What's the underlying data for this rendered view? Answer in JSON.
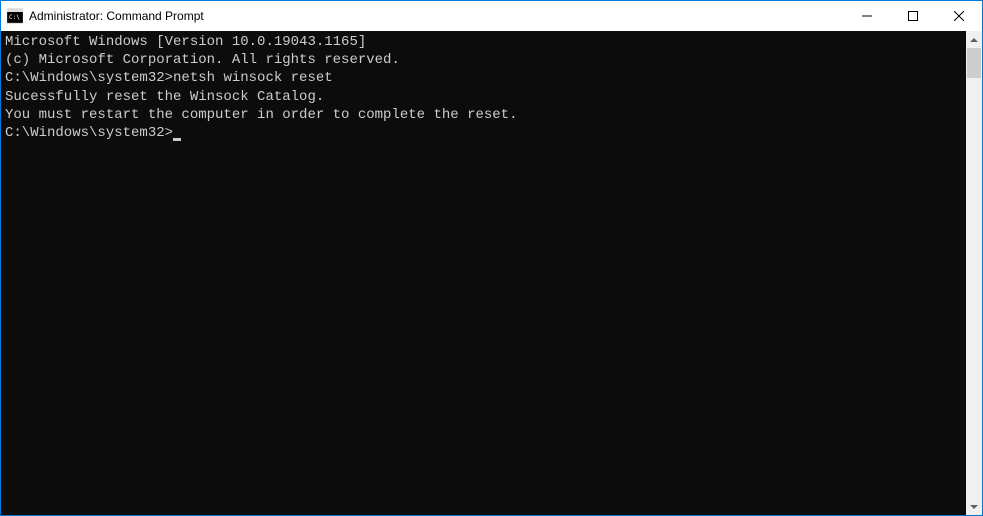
{
  "titlebar": {
    "title": "Administrator: Command Prompt"
  },
  "console": {
    "line1": "Microsoft Windows [Version 10.0.19043.1165]",
    "line2": "(c) Microsoft Corporation. All rights reserved.",
    "line3": "",
    "prompt1": "C:\\Windows\\system32>",
    "command1": "netsh winsock reset",
    "line4": "",
    "line5": "Sucessfully reset the Winsock Catalog.",
    "line6": "You must restart the computer in order to complete the reset.",
    "line7": "",
    "line8": "",
    "prompt2": "C:\\Windows\\system32>"
  }
}
